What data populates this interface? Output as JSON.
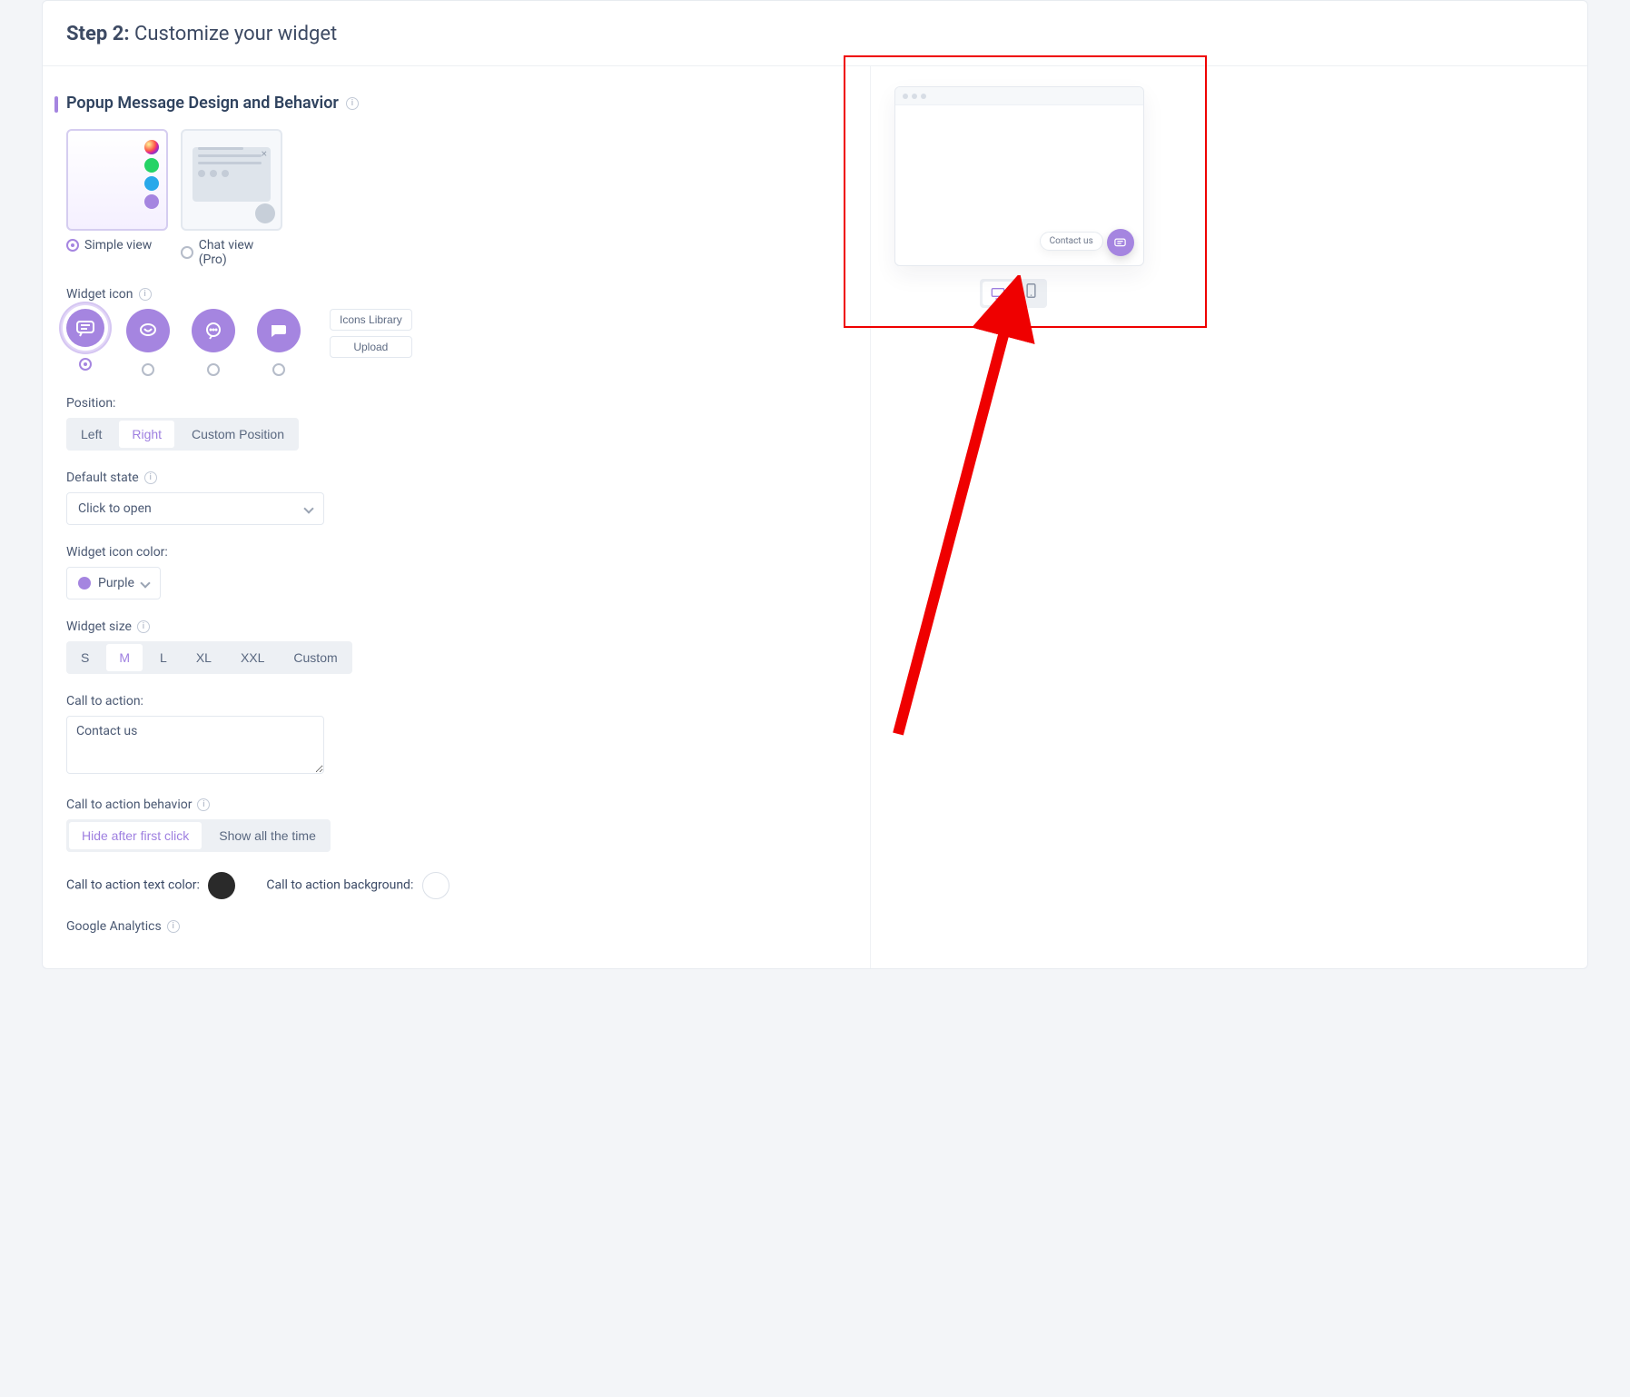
{
  "header": {
    "step_label": "Step 2:",
    "title": "Customize your widget"
  },
  "section": {
    "title": "Popup Message Design and Behavior"
  },
  "view_options": {
    "simple": "Simple view",
    "chat": "Chat view (Pro)"
  },
  "widget_icon": {
    "label": "Widget icon",
    "icons_library": "Icons Library",
    "upload": "Upload"
  },
  "position": {
    "label": "Position:",
    "left": "Left",
    "right": "Right",
    "custom": "Custom Position"
  },
  "default_state": {
    "label": "Default state",
    "value": "Click to open"
  },
  "widget_icon_color": {
    "label": "Widget icon color:",
    "value": "Purple",
    "hex": "#a585e0"
  },
  "widget_size": {
    "label": "Widget size",
    "options": [
      "S",
      "M",
      "L",
      "XL",
      "XXL",
      "Custom"
    ],
    "selected": "M"
  },
  "cta": {
    "label": "Call to action:",
    "value": "Contact us"
  },
  "cta_behavior": {
    "label": "Call to action behavior",
    "hide": "Hide after first click",
    "show": "Show all the time"
  },
  "cta_text_color": {
    "label": "Call to action text color:"
  },
  "cta_background": {
    "label": "Call to action background:"
  },
  "ga": {
    "label": "Google Analytics"
  },
  "preview": {
    "cta_text": "Contact us"
  }
}
